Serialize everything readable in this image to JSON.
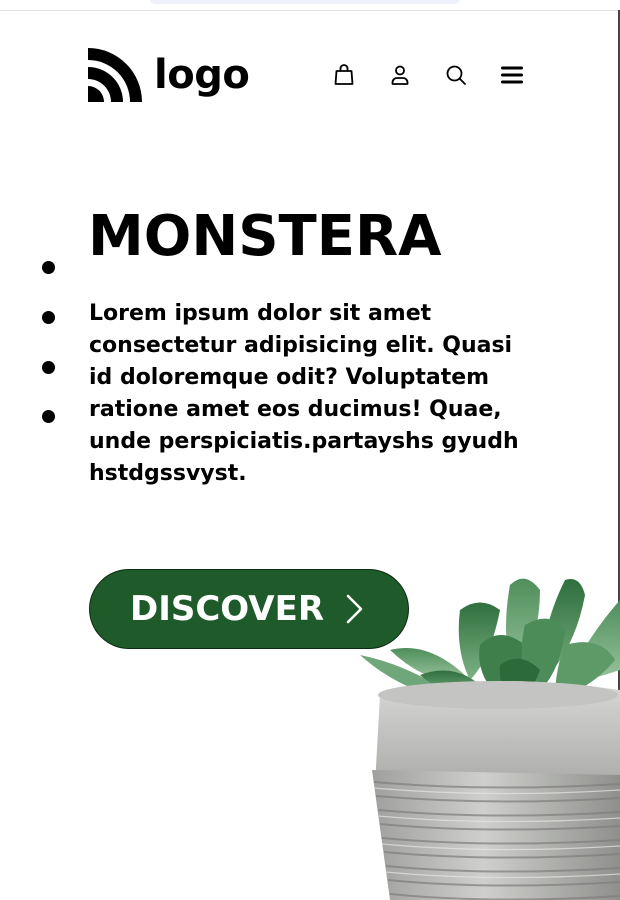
{
  "header": {
    "logo_text": "logo",
    "nav_icons": [
      "shopping-bag-icon",
      "user-icon",
      "search-icon",
      "menu-icon"
    ]
  },
  "hero": {
    "title": "MONSTERA",
    "body": "Lorem ipsum dolor sit amet consectetur adipisicing elit. Quasi id doloremque odit? Voluptatem ratione amet eos ducimus! Quae, unde perspiciatis.partayshs gyudh hstdgssvyst.",
    "cta_label": "DISCOVER",
    "cta_icon": "chevron-right-icon"
  },
  "colors": {
    "cta_background": "#1f5a2a",
    "text": "#000000",
    "background": "#ffffff"
  }
}
